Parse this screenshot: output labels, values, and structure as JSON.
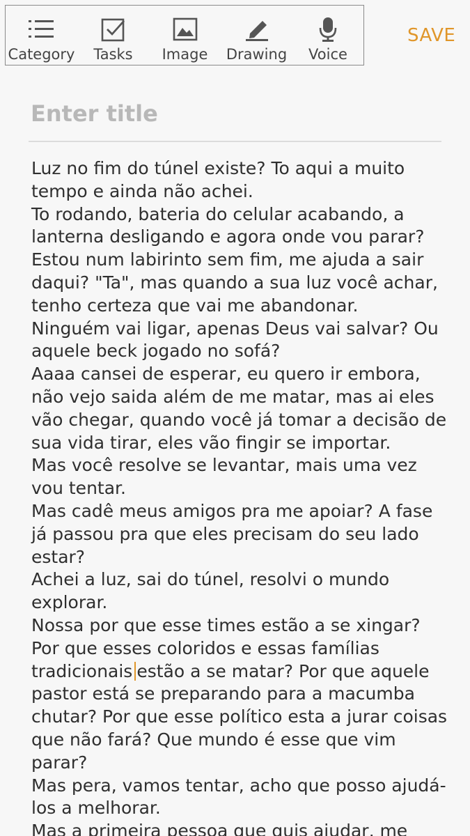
{
  "toolbar": {
    "items": [
      {
        "label": "Category",
        "icon": "category-list-icon"
      },
      {
        "label": "Tasks",
        "icon": "checkbox-icon"
      },
      {
        "label": "Image",
        "icon": "image-icon"
      },
      {
        "label": "Drawing",
        "icon": "pencil-icon"
      },
      {
        "label": "Voice",
        "icon": "microphone-icon"
      }
    ],
    "save_label": "SAVE"
  },
  "note": {
    "title_placeholder": "Enter title",
    "body_before_cursor": "Luz no fim do túnel existe? To aqui a muito tempo e ainda não achei.\nTo rodando, bateria do celular acabando, a lanterna desligando e agora onde vou parar?\nEstou num labirinto sem fim, me ajuda a sair daqui? \"Ta\", mas quando a sua luz você achar, tenho certeza que vai me abandonar.\nNinguém vai ligar, apenas Deus vai salvar? Ou aquele beck jogado no sofá?\nAaaa cansei de esperar, eu quero ir embora, não vejo saida além de me matar, mas ai eles vão chegar, quando você já tomar a decisão de sua vida tirar, eles vão fingir se importar.\nMas você resolve se levantar, mais uma vez vou tentar.\nMas cadê meus amigos pra me apoiar? A fase já passou pra que eles precisam do seu lado estar?\nAchei a luz, sai do túnel, resolvi o mundo explorar.\nNossa por que esse times estão a se xingar? Por que esses coloridos e essas famílias tradicionais",
    "body_after_cursor": "estão a se matar? Por que aquele pastor está se preparando para a macumba chutar? Por que esse político esta a jurar coisas que não fará? Que mundo é esse que vim parar?\nMas pera, vamos tentar, acho que posso ajudá-los a melhorar.\nMas a primeira pessoa que quis ajudar, me"
  },
  "colors": {
    "accent": "#e0962a",
    "background": "#f7f7f7",
    "text": "#2f2f2f",
    "placeholder": "#b8b8b8"
  }
}
